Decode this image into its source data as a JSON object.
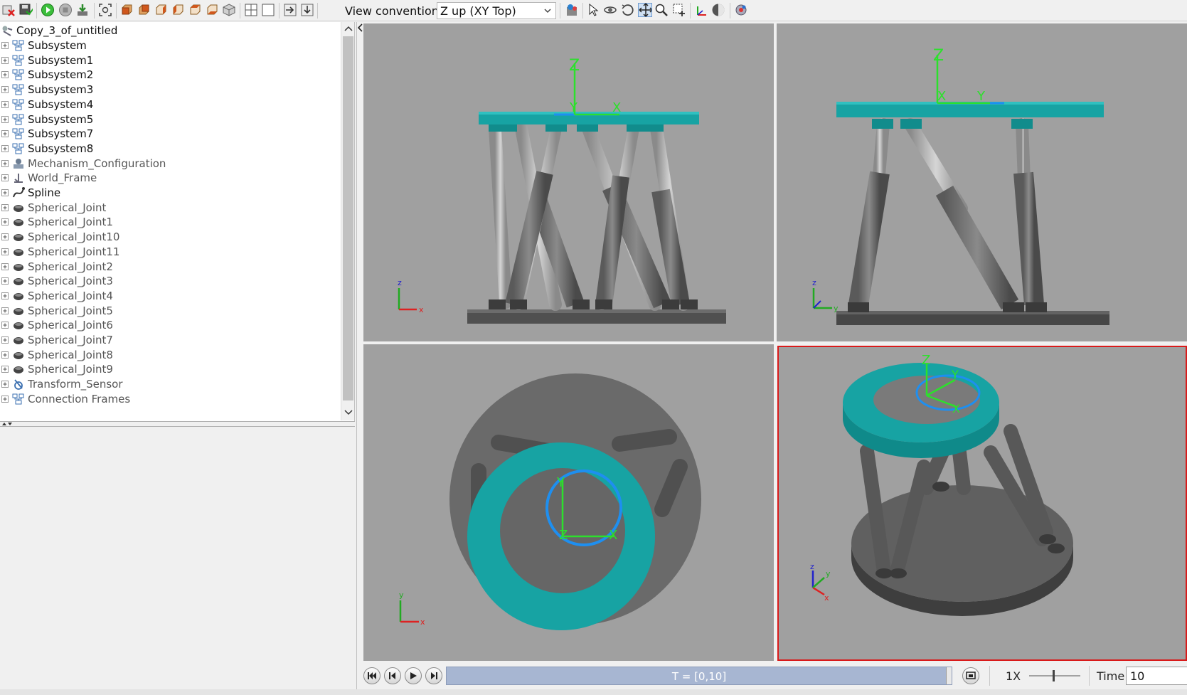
{
  "toolbar": {
    "view_convention_label": "View convention:",
    "view_convention_value": "Z up (XY Top)"
  },
  "tree": {
    "root": "Copy_3_of_untitled",
    "items": [
      {
        "label": "Subsystem",
        "kind": "subsystem",
        "grey": false
      },
      {
        "label": "Subsystem1",
        "kind": "subsystem",
        "grey": false
      },
      {
        "label": "Subsystem2",
        "kind": "subsystem",
        "grey": false
      },
      {
        "label": "Subsystem3",
        "kind": "subsystem",
        "grey": false
      },
      {
        "label": "Subsystem4",
        "kind": "subsystem",
        "grey": false
      },
      {
        "label": "Subsystem5",
        "kind": "subsystem",
        "grey": false
      },
      {
        "label": "Subsystem7",
        "kind": "subsystem",
        "grey": false
      },
      {
        "label": "Subsystem8",
        "kind": "subsystem",
        "grey": false
      },
      {
        "label": "Mechanism_Configuration",
        "kind": "mechanism",
        "grey": true
      },
      {
        "label": "World_Frame",
        "kind": "frame",
        "grey": true
      },
      {
        "label": "Spline",
        "kind": "spline",
        "grey": false
      },
      {
        "label": "Spherical_Joint",
        "kind": "joint",
        "grey": true
      },
      {
        "label": "Spherical_Joint1",
        "kind": "joint",
        "grey": true
      },
      {
        "label": "Spherical_Joint10",
        "kind": "joint",
        "grey": true
      },
      {
        "label": "Spherical_Joint11",
        "kind": "joint",
        "grey": true
      },
      {
        "label": "Spherical_Joint2",
        "kind": "joint",
        "grey": true
      },
      {
        "label": "Spherical_Joint3",
        "kind": "joint",
        "grey": true
      },
      {
        "label": "Spherical_Joint4",
        "kind": "joint",
        "grey": true
      },
      {
        "label": "Spherical_Joint5",
        "kind": "joint",
        "grey": true
      },
      {
        "label": "Spherical_Joint6",
        "kind": "joint",
        "grey": true
      },
      {
        "label": "Spherical_Joint7",
        "kind": "joint",
        "grey": true
      },
      {
        "label": "Spherical_Joint8",
        "kind": "joint",
        "grey": true
      },
      {
        "label": "Spherical_Joint9",
        "kind": "joint",
        "grey": true
      },
      {
        "label": "Transform_Sensor",
        "kind": "sensor",
        "grey": true
      },
      {
        "label": "Connection Frames",
        "kind": "subsystem",
        "grey": true
      }
    ]
  },
  "viewports": {
    "axis_x": "X",
    "axis_y": "Y",
    "axis_z": "Z",
    "triad_x": "x",
    "triad_y": "y",
    "triad_z": "z"
  },
  "playback": {
    "time_range": "T = [0,10]",
    "speed": "1X",
    "time_label": "Time",
    "time_value": "10"
  },
  "colors": {
    "platform": "#17a3a3",
    "leg": "#6d6d6d",
    "axis_green": "#2ce02c",
    "spline_blue": "#1e8ff0",
    "viewport_bg": "#a0a0a0",
    "selected_outline": "#d91a1a"
  }
}
